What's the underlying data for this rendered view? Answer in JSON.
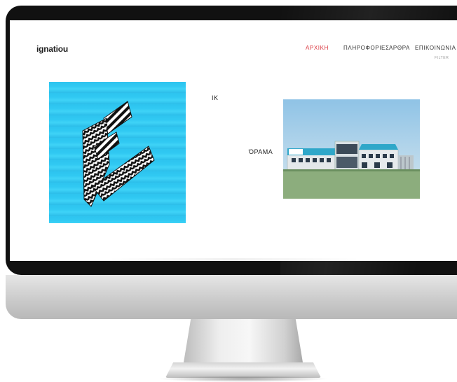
{
  "site": {
    "logo": "ignatiou"
  },
  "nav": {
    "items": [
      {
        "label": "ΑΡΧΙΚΗ",
        "active": true
      },
      {
        "label": "ΠΛΗΡΟΦΟΡΙΕΣ",
        "active": false
      },
      {
        "label": "ΑΡΘΡΑ",
        "active": false
      },
      {
        "label": "ΕΠΙΚΟΙΝΩΝΙΑ",
        "active": false
      }
    ],
    "filter": "FILTER"
  },
  "projects": [
    {
      "title": "ΙΚ"
    },
    {
      "title": "ΌΡΑΜΑ"
    }
  ],
  "colors": {
    "accent": "#d9363e",
    "tile_blue": "#2fc6f0",
    "bezel": "#111111"
  }
}
